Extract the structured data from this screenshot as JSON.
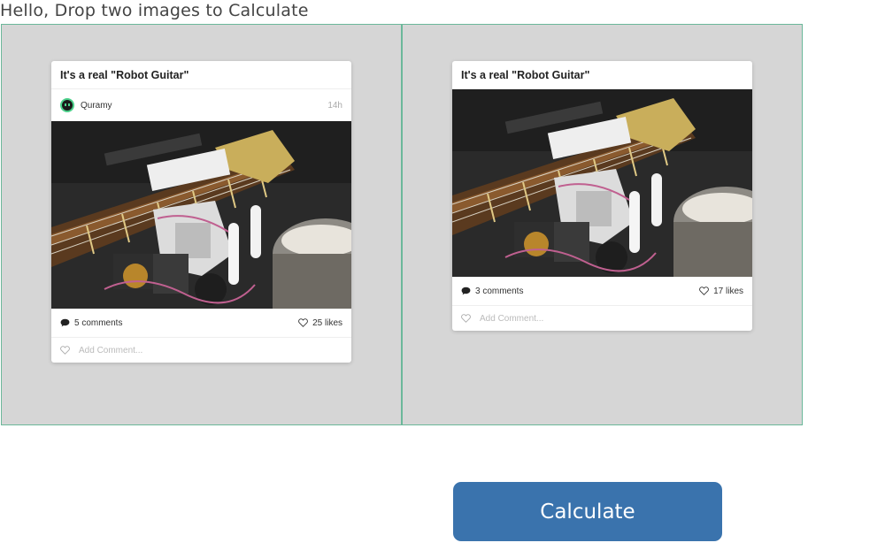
{
  "header": {
    "title": "Hello, Drop two images to Calculate"
  },
  "left_card": {
    "title": "It's a real \"Robot Guitar\"",
    "author": "Quramy",
    "time": "14h",
    "comments": "5 comments",
    "likes": "25 likes",
    "comment_placeholder": "Add Comment..."
  },
  "right_card": {
    "title": "It's a real \"Robot Guitar\"",
    "comments": "3 comments",
    "likes": "17 likes",
    "comment_placeholder": "Add Comment..."
  },
  "calculate_button": {
    "label": "Calculate"
  },
  "colors": {
    "drop_zone_bg": "#d6d6d6",
    "drop_zone_border": "#6bb89a",
    "button_bg": "#3a73ad",
    "avatar_accent": "#4cd08a"
  },
  "icons": {
    "comment": "speech-bubble-icon",
    "like": "heart-icon",
    "add_comment": "heart-outline-icon"
  }
}
